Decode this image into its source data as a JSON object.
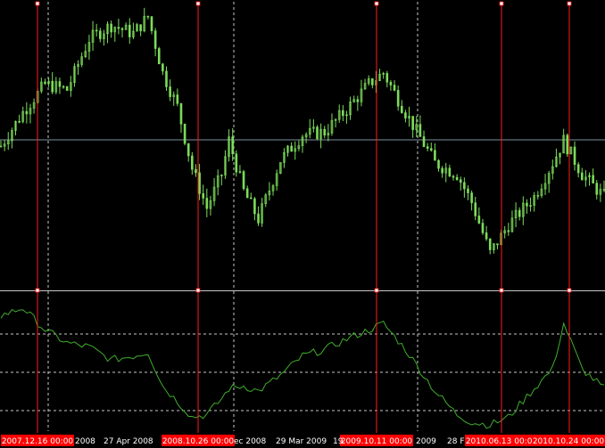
{
  "colors": {
    "background": "#000000",
    "candle": "#7ddc5a",
    "indicator_line": "#3fae2a",
    "marker_line": "#ff1a1a",
    "marker_label_bg": "#ff0000",
    "grid": "#c8c8c8",
    "price_line": "#7d8fa0",
    "axis_text": "#ffffff"
  },
  "time_axis": {
    "labels": [
      "2008",
      "27 Apr 2008",
      "ec 2008",
      "29 Mar 2009",
      "19",
      "2009",
      "28 F"
    ]
  },
  "markers": [
    {
      "label": "2007.12.16 00:00"
    },
    {
      "label": "2008.10.26 00:00"
    },
    {
      "label": "2009.10.11 00:00"
    },
    {
      "label": "2010.06.13 00:00"
    },
    {
      "label": "2010.10.24 00:00"
    }
  ],
  "chart_data": [
    {
      "type": "candlestick",
      "panel": "price",
      "x_count": 165,
      "ylim": [
        0,
        1
      ],
      "shape": [
        [
          0,
          0.5
        ],
        [
          6,
          0.62
        ],
        [
          12,
          0.72
        ],
        [
          18,
          0.7
        ],
        [
          24,
          0.88
        ],
        [
          30,
          0.93
        ],
        [
          36,
          0.9
        ],
        [
          40,
          0.96
        ],
        [
          44,
          0.76
        ],
        [
          48,
          0.64
        ],
        [
          52,
          0.42
        ],
        [
          56,
          0.28
        ],
        [
          60,
          0.4
        ],
        [
          62,
          0.52
        ],
        [
          66,
          0.34
        ],
        [
          70,
          0.24
        ],
        [
          76,
          0.45
        ],
        [
          82,
          0.54
        ],
        [
          88,
          0.55
        ],
        [
          94,
          0.63
        ],
        [
          100,
          0.72
        ],
        [
          104,
          0.76
        ],
        [
          110,
          0.62
        ],
        [
          118,
          0.44
        ],
        [
          124,
          0.4
        ],
        [
          128,
          0.3
        ],
        [
          133,
          0.12
        ],
        [
          138,
          0.22
        ],
        [
          145,
          0.32
        ],
        [
          150,
          0.44
        ],
        [
          153,
          0.52
        ],
        [
          158,
          0.4
        ],
        [
          164,
          0.32
        ]
      ]
    },
    {
      "type": "line",
      "panel": "indicator",
      "x_count": 165,
      "ylim": [
        0,
        1
      ],
      "shape": [
        [
          0,
          0.86
        ],
        [
          6,
          0.92
        ],
        [
          12,
          0.75
        ],
        [
          18,
          0.65
        ],
        [
          24,
          0.62
        ],
        [
          30,
          0.52
        ],
        [
          36,
          0.55
        ],
        [
          40,
          0.58
        ],
        [
          44,
          0.32
        ],
        [
          48,
          0.2
        ],
        [
          52,
          0.08
        ],
        [
          56,
          0.1
        ],
        [
          60,
          0.22
        ],
        [
          62,
          0.3
        ],
        [
          66,
          0.32
        ],
        [
          70,
          0.28
        ],
        [
          76,
          0.4
        ],
        [
          82,
          0.55
        ],
        [
          88,
          0.6
        ],
        [
          94,
          0.68
        ],
        [
          100,
          0.75
        ],
        [
          104,
          0.8
        ],
        [
          110,
          0.6
        ],
        [
          118,
          0.28
        ],
        [
          124,
          0.1
        ],
        [
          128,
          0.04
        ],
        [
          133,
          0.02
        ],
        [
          138,
          0.08
        ],
        [
          145,
          0.3
        ],
        [
          150,
          0.45
        ],
        [
          153,
          0.8
        ],
        [
          158,
          0.45
        ],
        [
          164,
          0.3
        ]
      ]
    }
  ]
}
